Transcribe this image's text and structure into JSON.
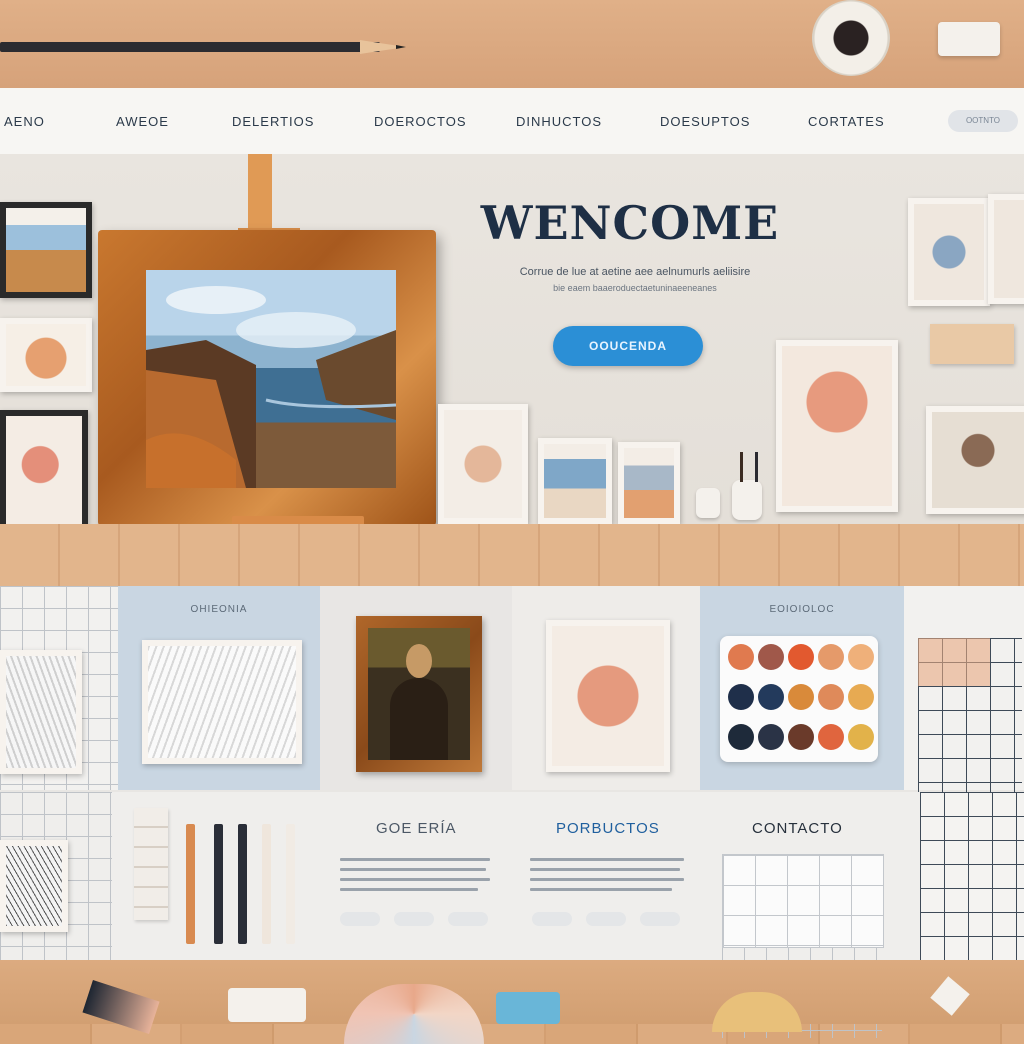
{
  "nav": {
    "items": [
      "AENO",
      "AWEOE",
      "DELERTIOS",
      "DOEROCTOS",
      "DINHUCTOS",
      "DOESUPTOS",
      "CORTATES"
    ],
    "button_label": "OOTNTO"
  },
  "hero": {
    "title": "WENCOME",
    "subtitle_line1": "Corrue de lue at aetine aee aelnumurls aeliisire",
    "subtitle_line2": "bie eaem baaeroduectaetuninaeeneanes",
    "cta_label": "OOUCENDA"
  },
  "cards": {
    "label_1": "OHIEONIA",
    "label_2": "EOIOIOLOC"
  },
  "sections": {
    "gallery_title": "GOE ERÍA",
    "products_title": "PORBUCTOS",
    "contact_title": "CONTACTO"
  },
  "colors": {
    "accent_blue": "#2b8fd6",
    "navy": "#1e2f45",
    "card_blue": "#c9d6e2"
  },
  "palette_colors": [
    "#e07a4f",
    "#a0584a",
    "#e2592f",
    "#e59a6a",
    "#efb07a",
    "#1f2f4a",
    "#233a5c",
    "#d98a3a",
    "#df8a5a",
    "#e7aa52",
    "#1e2a3a",
    "#2a3346",
    "#6a3a2a",
    "#e0653e",
    "#e2b24a"
  ]
}
